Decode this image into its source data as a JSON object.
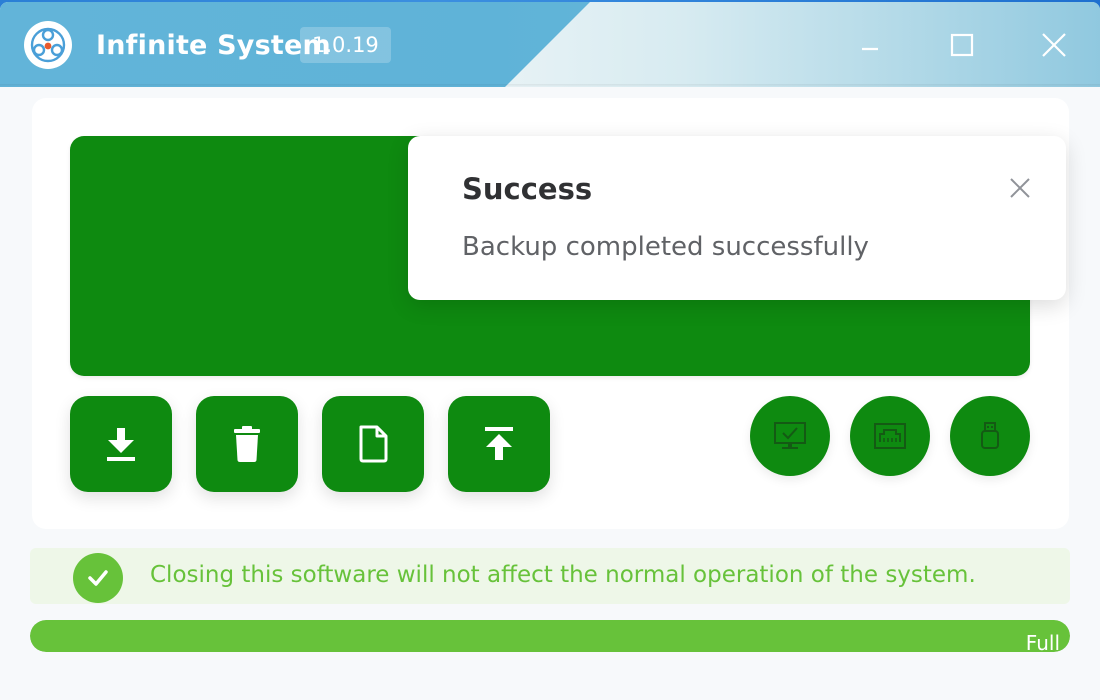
{
  "window": {
    "title": "Infinite System",
    "version": "1.0.19",
    "controls": {
      "minimize_icon": "minimize-icon",
      "maximize_icon": "maximize-icon",
      "close_icon": "close-icon"
    }
  },
  "colors": {
    "titlebar": "#62b4d9",
    "accent_green": "#0e8a10",
    "success_green": "#67c23a",
    "success_bg": "#eef7e8"
  },
  "actions": [
    {
      "name": "download-button",
      "icon": "download-icon"
    },
    {
      "name": "delete-button",
      "icon": "trash-icon"
    },
    {
      "name": "file-button",
      "icon": "file-icon"
    },
    {
      "name": "upload-button",
      "icon": "upload-icon"
    }
  ],
  "status_indicators": [
    {
      "name": "monitor-status",
      "icon": "monitor-check-icon"
    },
    {
      "name": "network-status",
      "icon": "ethernet-icon"
    },
    {
      "name": "usb-status",
      "icon": "usb-icon"
    }
  ],
  "toast": {
    "title": "Success",
    "message": "Backup completed successfully",
    "close_icon": "close-icon"
  },
  "notice": {
    "icon": "check-circle-icon",
    "text": "Closing this software will not affect the normal operation of the system."
  },
  "progress": {
    "percent": 100,
    "label": "Full"
  }
}
